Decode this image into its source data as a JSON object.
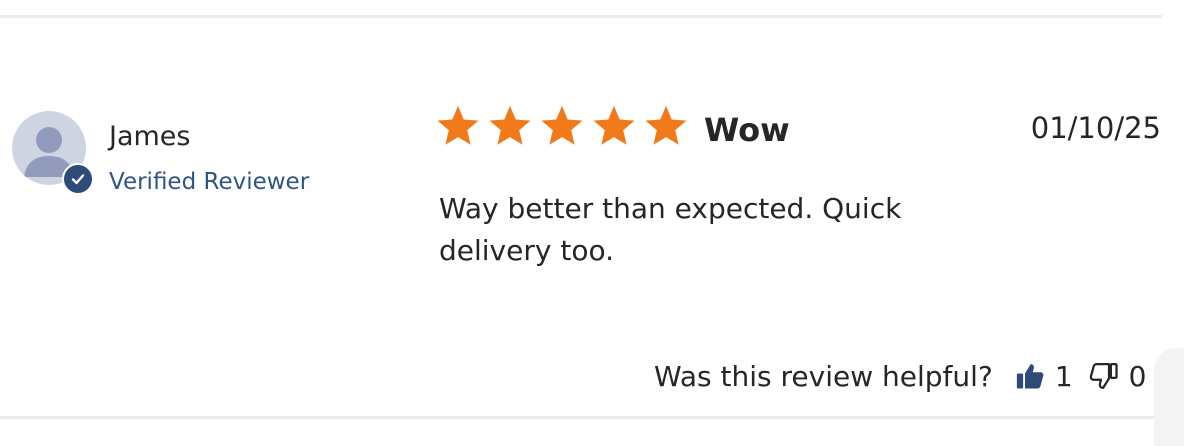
{
  "review": {
    "reviewer": {
      "name": "James",
      "status": "Verified Reviewer",
      "avatar_icon": "user-avatar-icon",
      "badge_icon": "check-icon",
      "badge_color": "#2d4a78"
    },
    "rating": {
      "value": 5,
      "max": 5,
      "star_color": "#f07a1a",
      "star_icon": "star-icon"
    },
    "title": "Wow",
    "date": "01/10/25",
    "body": "Way better than expected. Quick delivery too.",
    "helpful": {
      "question": "Was this review helpful?",
      "up_count": "1",
      "down_count": "0",
      "up_icon": "thumbs-up-icon",
      "down_icon": "thumbs-down-icon"
    }
  },
  "colors": {
    "link_blue": "#2f5585",
    "text": "#262626",
    "divider": "#ebebeb"
  }
}
